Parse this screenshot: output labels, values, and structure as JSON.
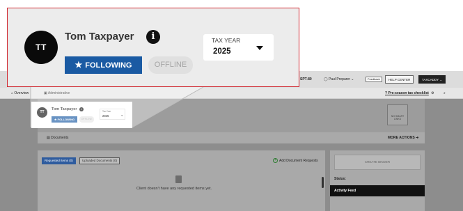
{
  "header": {
    "avatar_initials": "TT",
    "name": "Tom Taxpayer",
    "info_icon": "info-icon",
    "following_label": "FOLLOWING",
    "offline_label": "OFFLINE"
  },
  "tax_year": {
    "label": "TAX YEAR",
    "value": "2025"
  },
  "app_bar": {
    "client_id": "SPT-80",
    "user": "Paul Preparer",
    "feedback": "Feedback",
    "help_center": "HELP CENTER",
    "brand": "TAXCADDY"
  },
  "toolbar": {
    "overview": "Overview",
    "administrative": "Administrative",
    "checklist_link": "Pre-season tax checklist"
  },
  "profile": {
    "no_profile": "NO SMART LINKS"
  },
  "documents": {
    "title": "Documents",
    "more_actions": "MORE ACTIONS"
  },
  "tabs": {
    "requested": "Requested Items (0)",
    "uploaded": "Uploaded Documents (0)",
    "add_request": "Add Document Requests"
  },
  "empty_state": "Client doesn't have any requested items yet.",
  "side_panel": {
    "create_binder": "CREATE BINDER",
    "status": "Status:",
    "activity_feed": "Activity Feed"
  },
  "colors": {
    "brand_blue": "#1a5aa3",
    "callout_border": "#d0272f",
    "avatar_black": "#0a0a0a"
  }
}
